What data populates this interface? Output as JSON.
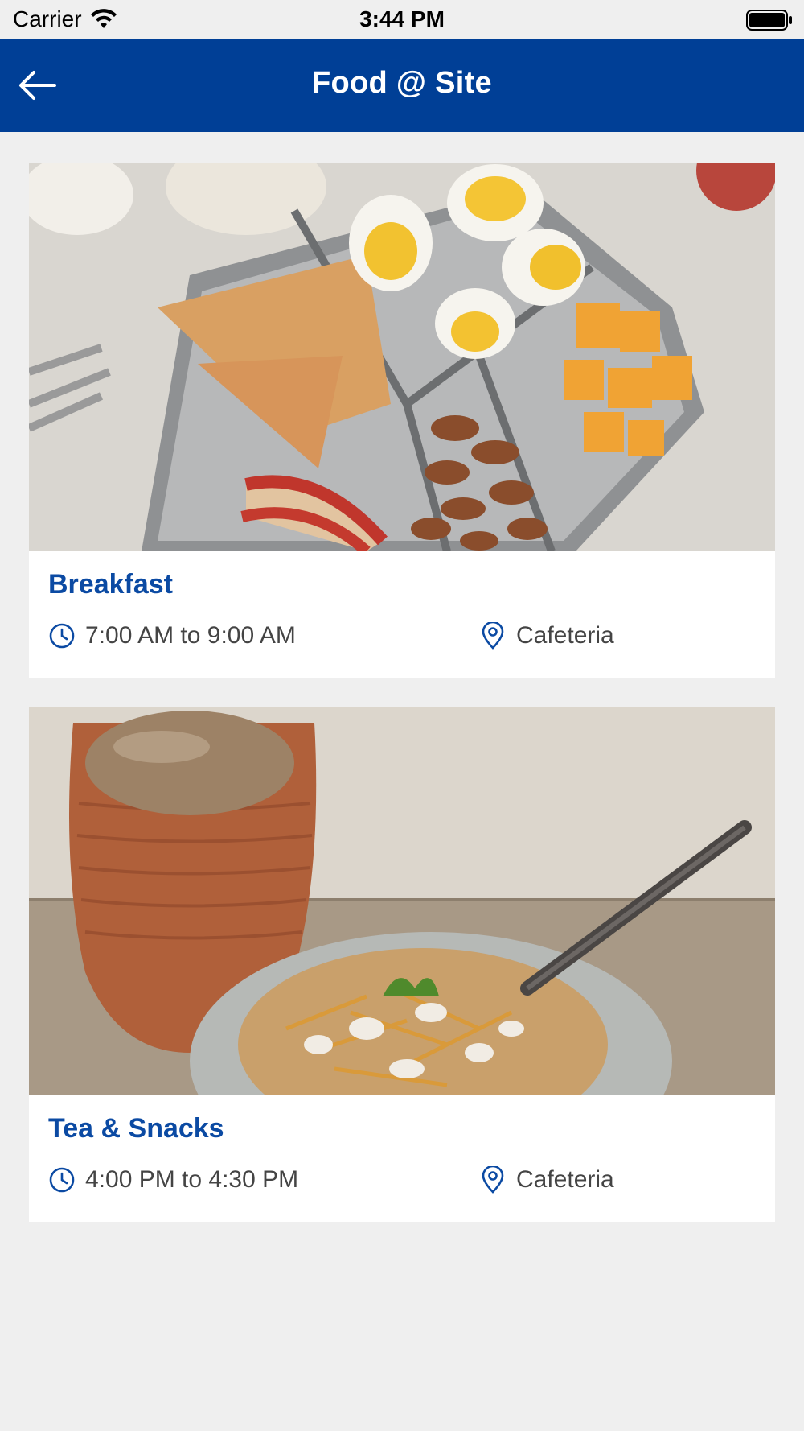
{
  "status_bar": {
    "carrier": "Carrier",
    "time": "3:44 PM"
  },
  "header": {
    "title": "Food @ Site"
  },
  "colors": {
    "header_bg": "#003f96",
    "title_accent": "#0b4aa3",
    "page_bg": "#efefef"
  },
  "meals": [
    {
      "name": "Breakfast",
      "time": "7:00 AM to 9:00 AM",
      "location": "Cafeteria",
      "photo": "breakfast-bento-box"
    },
    {
      "name": "Tea & Snacks",
      "time": "4:00 PM to 4:30 PM",
      "location": "Cafeteria",
      "photo": "tea-cup-and-chaat"
    }
  ]
}
